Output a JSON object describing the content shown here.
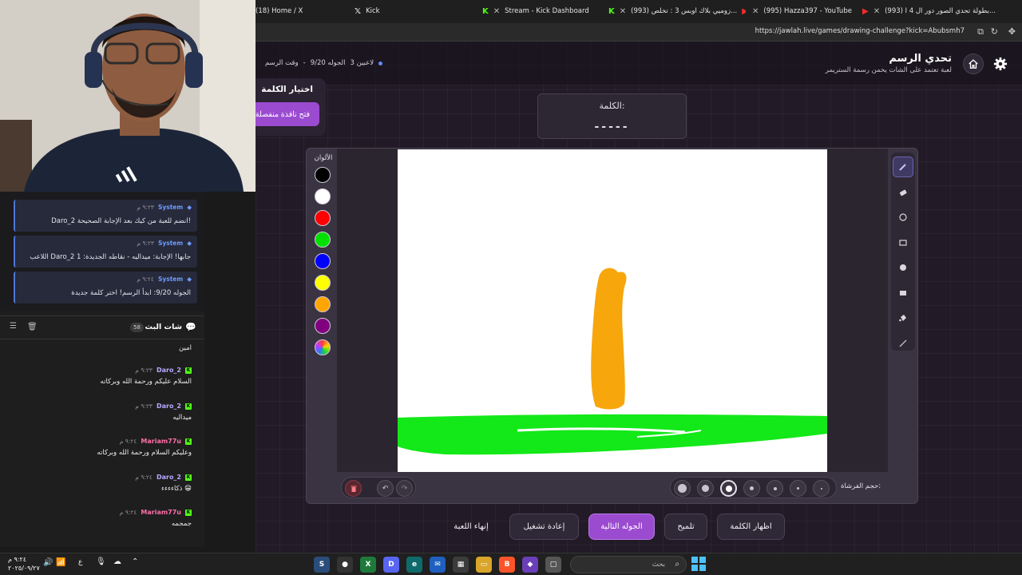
{
  "browser": {
    "tabs": [
      {
        "label": "(18) Home / X"
      },
      {
        "label": "Kick"
      },
      {
        "label": "Stream - Kick Dashboard"
      },
      {
        "label": "(993) زوميي بلاك اوبس 3 : تخلص..."
      },
      {
        "label": "(995) Hazza397 - YouTube"
      },
      {
        "label": "(993) بطولة تحدي الصور دور ال 4 ا..."
      }
    ],
    "url": "https://jawlah.live/games/drawing-challenge?kick=Abubsmh7"
  },
  "game": {
    "title": "تحدي الرسم",
    "subtitle": "لعبة تعتمد على الشات يخمن رسمة الستريمر",
    "players": "3 لاعبين",
    "round": "الجوله 9/20",
    "phase": "وقت الرسم",
    "word_select_title": "اختيار الكلمة",
    "popup_button": "فتح نافذة منفصلة",
    "word_label": "الكلمة:",
    "word_blanks": "-----",
    "colors_label": "الألوان",
    "colors": [
      "#000000",
      "#ffffff",
      "#ff0000",
      "#00e000",
      "#0000ff",
      "#ffff00",
      "#ffa500",
      "#800080"
    ],
    "brush_label": "حجم الفرشاة:",
    "tools": [
      "pencil-icon",
      "eraser-icon",
      "circle-icon",
      "rectangle-icon",
      "filled-circle-icon",
      "filled-rectangle-icon",
      "fill-bucket-icon",
      "line-icon"
    ],
    "buttons": {
      "show_word": "اظهار الكلمة",
      "hint": "تلميح",
      "next_round": "الجوله التالية",
      "restart": "إعادة تشغيل",
      "end_game": "إنهاء اللعبة"
    }
  },
  "chat": {
    "system_messages": [
      {
        "user": "System",
        "time": "٩:٢٣ م",
        "text": "Daro_2 انضم للعبة من كيك بعد الإجابة الصحيحة!"
      },
      {
        "user": "System",
        "time": "٩:٢٣ م",
        "text": "اللاعب Daro_2 جابها! الإجابة: ميداليه - نقاطه الجديدة: 1"
      },
      {
        "user": "System",
        "time": "٩:٢٤ م",
        "text": "الجوله 9/20: ابدأ الرسم! اختر كلمة جديدة"
      }
    ],
    "title": "شات البث",
    "viewer_count": "58",
    "first_line": "امين",
    "messages": [
      {
        "user": "Daro_2",
        "time": "٩:٢٣ م",
        "text": "السلام عليكم ورحمة الله وبركاته",
        "color": "#b7a8ff"
      },
      {
        "user": "Daro_2",
        "time": "٩:٢٣ م",
        "text": "ميداليه",
        "color": "#b7a8ff"
      },
      {
        "user": "Mariam77u",
        "time": "٩:٢٤ م",
        "text": "وعليكم السلام ورحمة الله وبركاته",
        "color": "#ff6fa8"
      },
      {
        "user": "Daro_2",
        "time": "٩:٢٤ م",
        "text": "ذكاءءءء 😁",
        "color": "#b7a8ff"
      },
      {
        "user": "Mariam77u",
        "time": "٩:٢٤ م",
        "text": "جمجمه",
        "color": "#ff6fa8"
      }
    ]
  },
  "taskbar": {
    "search_placeholder": "بحث",
    "time": "٩:٢٤ م",
    "date": "٢٠٢٥/٠٩/٢٧",
    "lang": "ع"
  }
}
